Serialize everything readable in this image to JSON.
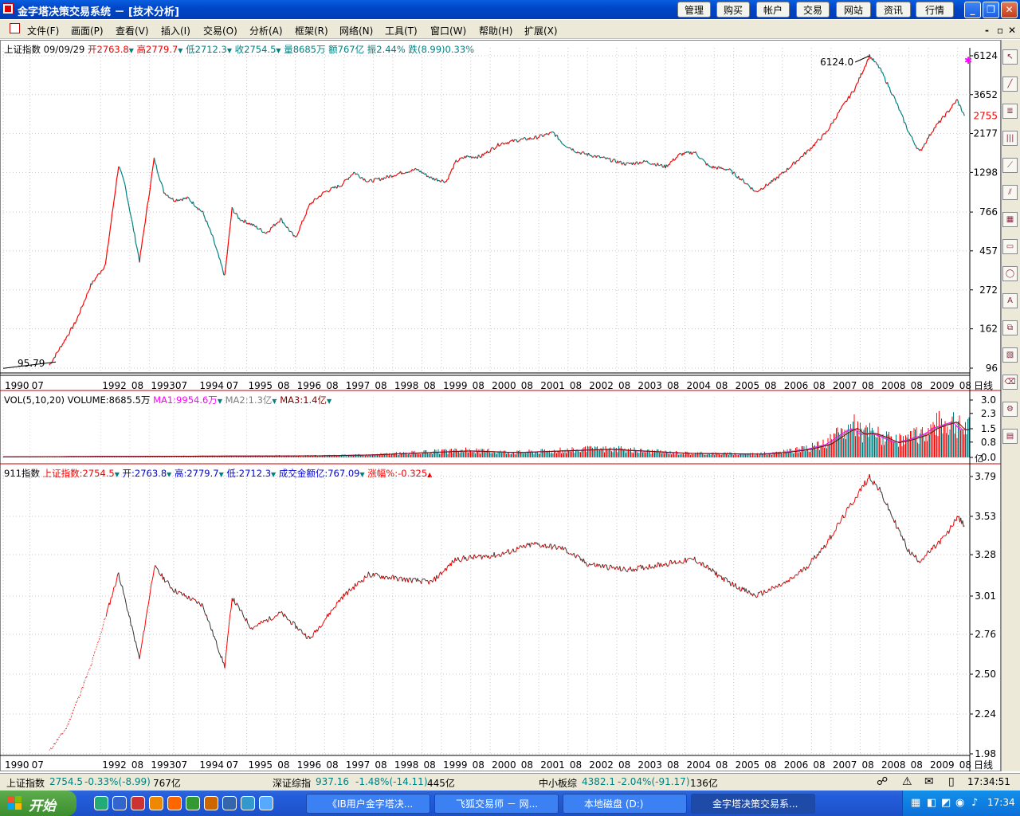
{
  "window": {
    "title": "金字塔决策交易系统 － [技术分析]",
    "nav_buttons": [
      "管理",
      "购买",
      "帐户",
      "交易",
      "网站",
      "资讯",
      "行情"
    ],
    "controls": {
      "minimize": "_",
      "restore": "❐",
      "close": "✕"
    }
  },
  "menu": [
    "文件(F)",
    "画面(P)",
    "查看(V)",
    "插入(I)",
    "交易(O)",
    "分析(A)",
    "框架(R)",
    "网络(N)",
    "工具(T)",
    "窗口(W)",
    "帮助(H)",
    "扩展(X)"
  ],
  "mdi_controls": {
    "min": "-",
    "restore": "▫",
    "close": "✕"
  },
  "main_panel": {
    "name": "上证指数",
    "date": "09/09/29",
    "open": "开2763.8",
    "high": "高2779.7",
    "low": "低2712.3",
    "close": "收2754.5",
    "volume": "量8685万",
    "amount": "额767亿",
    "amplitude": "振2.44%",
    "change": "跌(8.99)0.33%",
    "peak_label": "6124.0",
    "trough_label": "95.79",
    "current_price": "2755",
    "y_ticks": [
      "6124",
      "3652",
      "2177",
      "1298",
      "766",
      "457",
      "272",
      "162",
      "96"
    ],
    "x_axis": [
      "1990",
      "07",
      "1992",
      "08",
      "1993",
      "07",
      "1994",
      "07",
      "1995",
      "08",
      "1996",
      "08",
      "1997",
      "08",
      "1998",
      "08",
      "1999",
      "08",
      "2000",
      "08",
      "2001",
      "08",
      "2002",
      "08",
      "2003",
      "08",
      "2004",
      "08",
      "2005",
      "08",
      "2006",
      "08",
      "2007",
      "08",
      "2008",
      "08",
      "2009",
      "08"
    ],
    "period": "日线"
  },
  "volume_panel": {
    "title": "VOL(5,10,20) VOLUME:8685.5万",
    "ma1": "MA1:9954.6万",
    "ma2": "MA2:1.3亿",
    "ma3": "MA3:1.4亿",
    "y_ticks": [
      "3.0",
      "2.3",
      "1.5",
      "0.8",
      "0.0"
    ],
    "unit": "亿"
  },
  "indicator_panel": {
    "name": "911指数",
    "index": "上证指数:2754.5",
    "open": "开:2763.8",
    "high": "高:2779.7",
    "low": "低:2712.3",
    "amount": "成交金额亿:767.09",
    "change": "涨幅%:-0.325",
    "y_ticks": [
      "3.79",
      "3.53",
      "3.28",
      "3.01",
      "2.76",
      "2.50",
      "2.24",
      "1.98"
    ],
    "period": "日线"
  },
  "chart_data": [
    {
      "type": "line",
      "title": "上证指数",
      "scale": "log",
      "ylim": [
        96,
        6124
      ],
      "x": [
        1990.95,
        1991.2,
        1991.5,
        1991.8,
        1992.1,
        1992.37,
        1992.5,
        1992.8,
        1993.1,
        1993.3,
        1993.5,
        1993.8,
        1994.1,
        1994.3,
        1994.55,
        1994.7,
        1994.85,
        1995.1,
        1995.4,
        1995.7,
        1996.0,
        1996.3,
        1996.6,
        1996.95,
        1997.2,
        1997.5,
        1997.8,
        1998.2,
        1998.5,
        1998.8,
        1999.1,
        1999.3,
        1999.5,
        1999.8,
        2000.2,
        2000.6,
        2000.9,
        2001.3,
        2001.5,
        2001.8,
        2002.0,
        2002.4,
        2002.8,
        2003.2,
        2003.6,
        2003.9,
        2004.2,
        2004.5,
        2004.9,
        2005.3,
        2005.45,
        2005.8,
        2006.1,
        2006.5,
        2006.9,
        2007.2,
        2007.5,
        2007.79,
        2008.0,
        2008.3,
        2008.6,
        2008.82,
        2009.1,
        2009.4,
        2009.59,
        2009.74
      ],
      "y": [
        100,
        130,
        180,
        290,
        380,
        1420,
        1100,
        400,
        1550,
        1000,
        900,
        920,
        760,
        550,
        325,
        800,
        700,
        650,
        580,
        700,
        540,
        850,
        1000,
        1100,
        1300,
        1150,
        1200,
        1300,
        1350,
        1200,
        1150,
        1500,
        1600,
        1600,
        1900,
        2000,
        2050,
        2200,
        1900,
        1700,
        1650,
        1550,
        1450,
        1500,
        1400,
        1650,
        1700,
        1400,
        1350,
        1100,
        1000,
        1150,
        1350,
        1700,
        2200,
        3000,
        4000,
        6124,
        5200,
        3500,
        2200,
        1700,
        2300,
        2900,
        3400,
        2755
      ],
      "annotations": [
        {
          "label": "6124.0",
          "x": 2007.79,
          "y": 6124
        },
        {
          "label": "95.79",
          "x": 1990.95,
          "y": 95.79
        }
      ]
    },
    {
      "type": "bar",
      "title": "VOL(5,10,20)",
      "ylabel": "亿",
      "ylim": [
        0,
        3.0
      ],
      "x": [
        1996.5,
        1997.5,
        1999.5,
        2000.5,
        2002.4,
        2004.0,
        2005.5,
        2006.0,
        2006.5,
        2006.9,
        2007.1,
        2007.3,
        2007.45,
        2007.6,
        2007.8,
        2008.0,
        2008.3,
        2008.6,
        2008.9,
        2009.1,
        2009.3,
        2009.5,
        2009.65
      ],
      "values": [
        0.1,
        0.15,
        0.4,
        0.3,
        0.5,
        0.25,
        0.2,
        0.3,
        0.5,
        0.8,
        1.2,
        1.6,
        1.8,
        1.4,
        1.5,
        1.3,
        0.9,
        1.1,
        1.4,
        1.8,
        2.0,
        2.2,
        1.7
      ]
    },
    {
      "type": "line",
      "title": "911指数",
      "ylim": [
        1.98,
        3.79
      ],
      "x": [
        1990.95,
        1991.3,
        1991.8,
        1992.37,
        1992.8,
        1993.1,
        1993.5,
        1994.1,
        1994.55,
        1994.7,
        1995.1,
        1995.7,
        1996.3,
        1996.95,
        1997.5,
        1998.2,
        1998.8,
        1999.3,
        2000.2,
        2000.9,
        2001.5,
        2002.0,
        2002.8,
        2003.6,
        2004.2,
        2004.9,
        2005.45,
        2006.1,
        2006.5,
        2006.9,
        2007.2,
        2007.5,
        2007.79,
        2008.0,
        2008.3,
        2008.6,
        2008.82,
        2009.1,
        2009.4,
        2009.59,
        2009.74
      ],
      "y": [
        2.0,
        2.15,
        2.55,
        3.16,
        2.6,
        3.2,
        3.05,
        2.95,
        2.55,
        3.0,
        2.8,
        2.9,
        2.73,
        3.0,
        3.15,
        3.12,
        3.1,
        3.25,
        3.28,
        3.35,
        3.32,
        3.22,
        3.18,
        3.22,
        3.25,
        3.1,
        3.01,
        3.1,
        3.2,
        3.35,
        3.5,
        3.65,
        3.79,
        3.7,
        3.5,
        3.3,
        3.24,
        3.32,
        3.42,
        3.53,
        3.47
      ]
    }
  ],
  "status": {
    "sh": {
      "name": "上证指数",
      "val": "2754.5",
      "chg": "-0.33%(-8.99)",
      "amt": "767亿"
    },
    "sz": {
      "name": "深证综指",
      "val": "937.16",
      "chg": "-1.48%(-14.11)",
      "amt": "445亿"
    },
    "zx": {
      "name": "中小板综",
      "val": "4382.1",
      "chg": "-2.04%(-91.17)",
      "amt": "136亿"
    },
    "time": "17:34:51"
  },
  "taskbar": {
    "start": "开始",
    "tasks": [
      "《IB用户金字塔决...",
      "飞狐交易师 － 网...",
      "本地磁盘 (D:)",
      "金字塔决策交易系..."
    ],
    "clock": "17:34"
  },
  "colors": {
    "up": "#ff0000",
    "down": "#008080",
    "titlebar": "#0046c8",
    "ma1": "#ff00ff",
    "ma2": "#808080",
    "ma3": "#800000"
  }
}
